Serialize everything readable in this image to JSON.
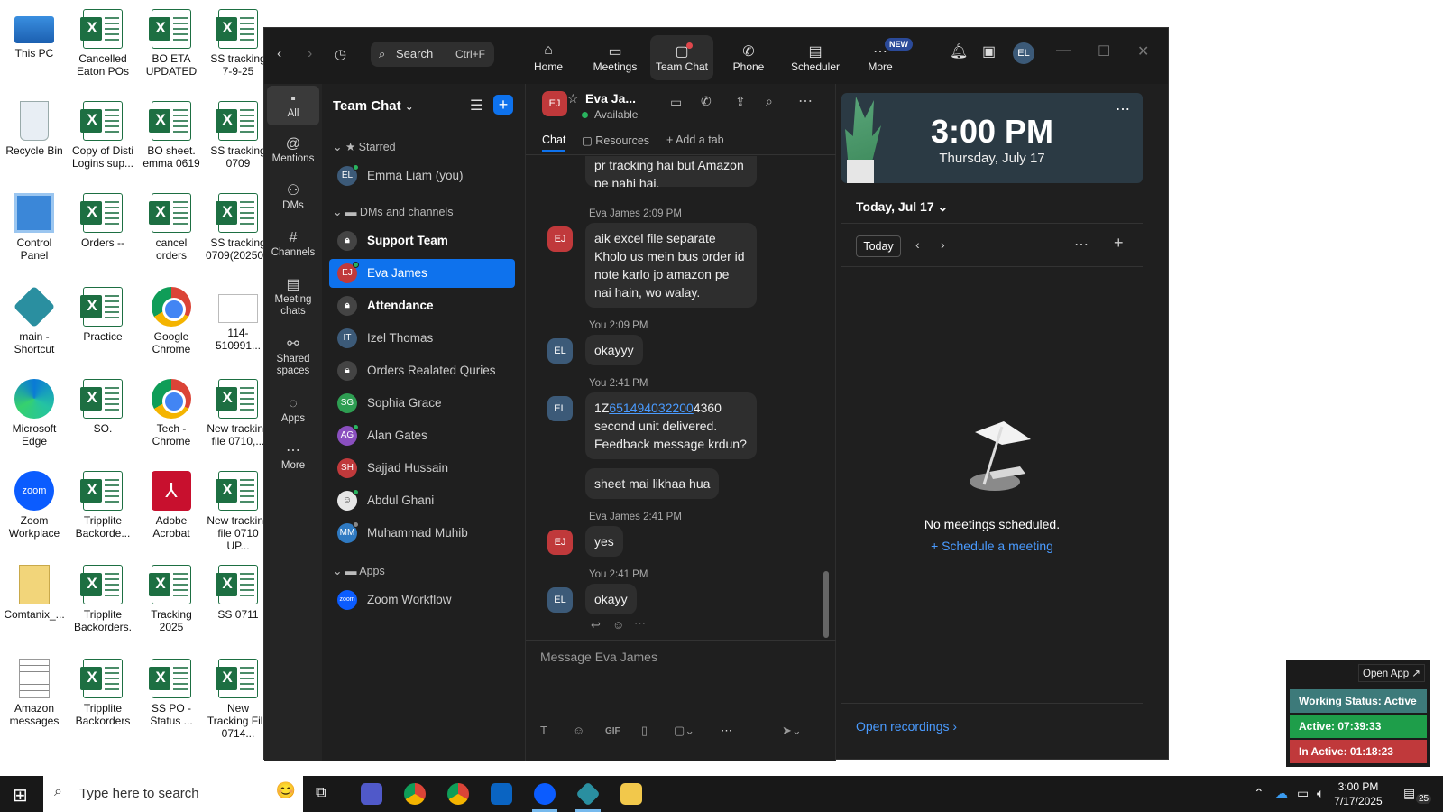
{
  "desktop": {
    "icons": [
      {
        "label": "This PC"
      },
      {
        "label": "Cancelled Eaton POs"
      },
      {
        "label": "BO ETA UPDATED"
      },
      {
        "label": "SS tracking 7-9-25"
      },
      {
        "label": "Recycle Bin"
      },
      {
        "label": "Copy of Disti Logins sup..."
      },
      {
        "label": "BO sheet. emma 0619"
      },
      {
        "label": "SS tracking 0709"
      },
      {
        "label": "Control Panel"
      },
      {
        "label": "Orders --"
      },
      {
        "label": "cancel orders"
      },
      {
        "label": "SS tracking 0709(20250..."
      },
      {
        "label": "main - Shortcut"
      },
      {
        "label": "Practice"
      },
      {
        "label": "Google Chrome"
      },
      {
        "label": "114-510991..."
      },
      {
        "label": "Microsoft Edge"
      },
      {
        "label": "SO."
      },
      {
        "label": "Tech - Chrome"
      },
      {
        "label": "New tracking file 0710,..."
      },
      {
        "label": "Zoom Workplace"
      },
      {
        "label": "Tripplite Backorde..."
      },
      {
        "label": "Adobe Acrobat"
      },
      {
        "label": "New tracking file 0710 UP..."
      },
      {
        "label": "Comtanix_..."
      },
      {
        "label": "Tripplite Backorders."
      },
      {
        "label": "Tracking 2025"
      },
      {
        "label": "SS 0711"
      },
      {
        "label": "Amazon messages"
      },
      {
        "label": "Tripplite Backorders"
      },
      {
        "label": "SS PO - Status ..."
      },
      {
        "label": "New Tracking File 0714..."
      }
    ]
  },
  "zoom": {
    "search": {
      "label": "Search",
      "shortcut": "Ctrl+F"
    },
    "topnav": [
      {
        "label": "Home",
        "icon": "home-icon"
      },
      {
        "label": "Meetings",
        "icon": "video-icon"
      },
      {
        "label": "Team Chat",
        "icon": "chat-icon"
      },
      {
        "label": "Phone",
        "icon": "phone-icon"
      },
      {
        "label": "Scheduler",
        "icon": "calendar-icon"
      },
      {
        "label": "More",
        "icon": "more-icon",
        "badge": "NEW"
      }
    ],
    "profile_initials": "EL",
    "rail": [
      {
        "label": "All"
      },
      {
        "label": "Mentions"
      },
      {
        "label": "DMs"
      },
      {
        "label": "Channels"
      },
      {
        "label": "Meeting chats"
      },
      {
        "label": "Shared spaces"
      },
      {
        "label": "Apps"
      },
      {
        "label": "More"
      }
    ],
    "chatlist": {
      "title": "Team Chat",
      "sections": {
        "starred": "Starred",
        "dms": "DMs and channels",
        "apps": "Apps"
      },
      "starred": [
        {
          "initials": "EL",
          "name": "Emma Liam (you)"
        }
      ],
      "items": [
        {
          "initials": "",
          "name": "Support Team"
        },
        {
          "initials": "EJ",
          "name": "Eva James"
        },
        {
          "initials": "",
          "name": "Attendance"
        },
        {
          "initials": "IT",
          "name": "Izel Thomas"
        },
        {
          "initials": "",
          "name": "Orders Realated Quries"
        },
        {
          "initials": "SG",
          "name": "Sophia Grace"
        },
        {
          "initials": "AG",
          "name": "Alan Gates"
        },
        {
          "initials": "SH",
          "name": "Sajjad Hussain"
        },
        {
          "initials": "",
          "name": "Abdul Ghani"
        },
        {
          "initials": "MM",
          "name": "Muhammad Muhib"
        }
      ],
      "apps": [
        {
          "initials": "zoom",
          "name": "Zoom Workflow"
        }
      ]
    },
    "chat": {
      "avatar": "EJ",
      "name": "Eva Ja...",
      "status": "Available",
      "tabs": {
        "chat": "Chat",
        "resources": "Resources",
        "add": "Add a tab"
      },
      "partial_text": "pr tracking hai but Amazon pe nahi hai.",
      "messages": [
        {
          "meta": "Eva James 2:09 PM",
          "avatar": "EJ",
          "text": "aik excel file separate Kholo us mein bus order id note karlo jo amazon pe nai hain, wo walay."
        },
        {
          "meta": "You 2:09 PM",
          "avatar": "EL",
          "text": "okayyy"
        },
        {
          "meta": "You 2:41 PM",
          "avatar": "EL",
          "text_prefix": "1Z",
          "text_link": "651494032200",
          "text_suffix": "4360 second unit delivered. Feedback message krdun?",
          "text2": "sheet mai likhaa hua"
        },
        {
          "meta": "Eva James 2:41 PM",
          "avatar": "EJ",
          "text": "yes"
        },
        {
          "meta": "You 2:41 PM",
          "avatar": "EL",
          "text": "okayy"
        }
      ],
      "composer_placeholder": "Message Eva James",
      "gif": "GIF"
    },
    "calendar_panel": {
      "time": "3:00 PM",
      "date": "Thursday, July 17",
      "today_header": "Today, Jul 17",
      "today_button": "Today",
      "empty": "No meetings scheduled.",
      "schedule_link": "Schedule a meeting",
      "recordings": "Open recordings"
    }
  },
  "status_widget": {
    "open_app": "Open App ↗",
    "working": "Working Status: Active",
    "active": "Active: 07:39:33",
    "inactive": "In Active: 01:18:23",
    "colors": {
      "working": "#3d7a7a",
      "active": "#1e9e4a",
      "inactive": "#c0393b"
    }
  },
  "taskbar": {
    "search_placeholder": "Type here to search",
    "time": "3:00 PM",
    "date": "7/17/2025",
    "notifications": "25"
  }
}
